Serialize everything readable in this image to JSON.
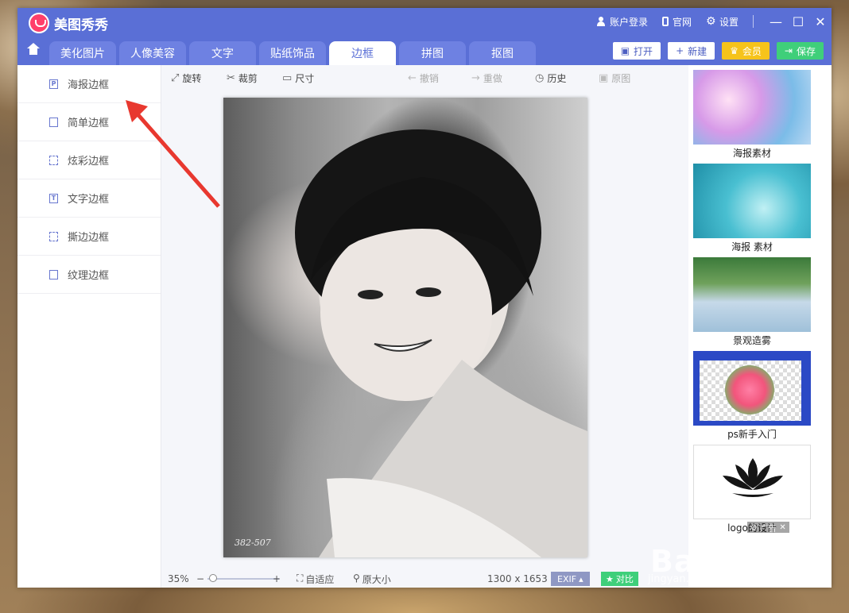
{
  "app": {
    "title": "美图秀秀"
  },
  "top_right": {
    "login": "账户登录",
    "website": "官网",
    "settings": "设置"
  },
  "tabs": [
    {
      "label": "美化图片"
    },
    {
      "label": "人像美容"
    },
    {
      "label": "文字"
    },
    {
      "label": "贴纸饰品"
    },
    {
      "label": "边框"
    },
    {
      "label": "拼图"
    },
    {
      "label": "抠图"
    }
  ],
  "active_tab": "边框",
  "actions": {
    "open": "打开",
    "new": "新建",
    "vip": "会员",
    "save": "保存"
  },
  "sidebar": {
    "items": [
      {
        "label": "海报边框",
        "icon": "P"
      },
      {
        "label": "简单边框",
        "icon": ""
      },
      {
        "label": "炫彩边框",
        "icon": ""
      },
      {
        "label": "文字边框",
        "icon": "T"
      },
      {
        "label": "撕边边框",
        "icon": ""
      },
      {
        "label": "纹理边框",
        "icon": ""
      }
    ]
  },
  "toolbar": {
    "rotate": "旋转",
    "crop": "裁剪",
    "size": "尺寸",
    "undo": "撤销",
    "redo": "重做",
    "history": "历史",
    "original": "原图"
  },
  "photo": {
    "caption": "382-507"
  },
  "status": {
    "zoom": "35%",
    "minus": "−",
    "plus": "+",
    "fit": "自适应",
    "actual": "原大小",
    "dimensions": "1300 x 1653",
    "exif": "EXIF",
    "compare": "对比"
  },
  "zoom_level": 0.35,
  "materials": [
    {
      "label": "海报素材"
    },
    {
      "label": "海报 素材"
    },
    {
      "label": "景观造雾"
    },
    {
      "label": "ps新手入门"
    },
    {
      "label": "logo的设计"
    }
  ],
  "ad": {
    "label": "广告"
  },
  "watermark": {
    "main": "Bai 经验",
    "sub": "jingyan.baidu.com"
  },
  "colors": {
    "titlebar": "#5a6fd6",
    "tab": "#6e81e2",
    "vip": "#f6c31b",
    "save": "#3fcf7a",
    "arrow": "#e8382f"
  }
}
